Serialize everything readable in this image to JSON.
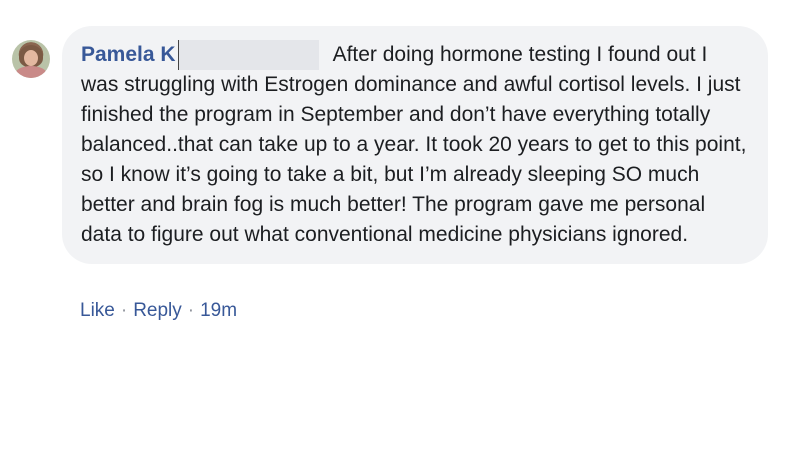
{
  "comment": {
    "author": "Pamela K",
    "text": "After doing hormone testing I found out I was struggling with Estrogen dominance and awful cortisol levels. I just finished the program in September and don’t have everything totally balanced..that can take up to a year. It took 20 years to get to this point, so I know it’s going to take a bit, but I’m already sleeping SO much better and brain fog is much better! The program gave me personal data to figure out what conventional medicine physicians ignored.",
    "avatar_icon": "profile-photo",
    "accent_color": "#385898",
    "bubble_color": "#f2f3f5"
  },
  "actions": {
    "like_label": "Like",
    "reply_label": "Reply",
    "separator": "·",
    "timestamp": "19m"
  }
}
